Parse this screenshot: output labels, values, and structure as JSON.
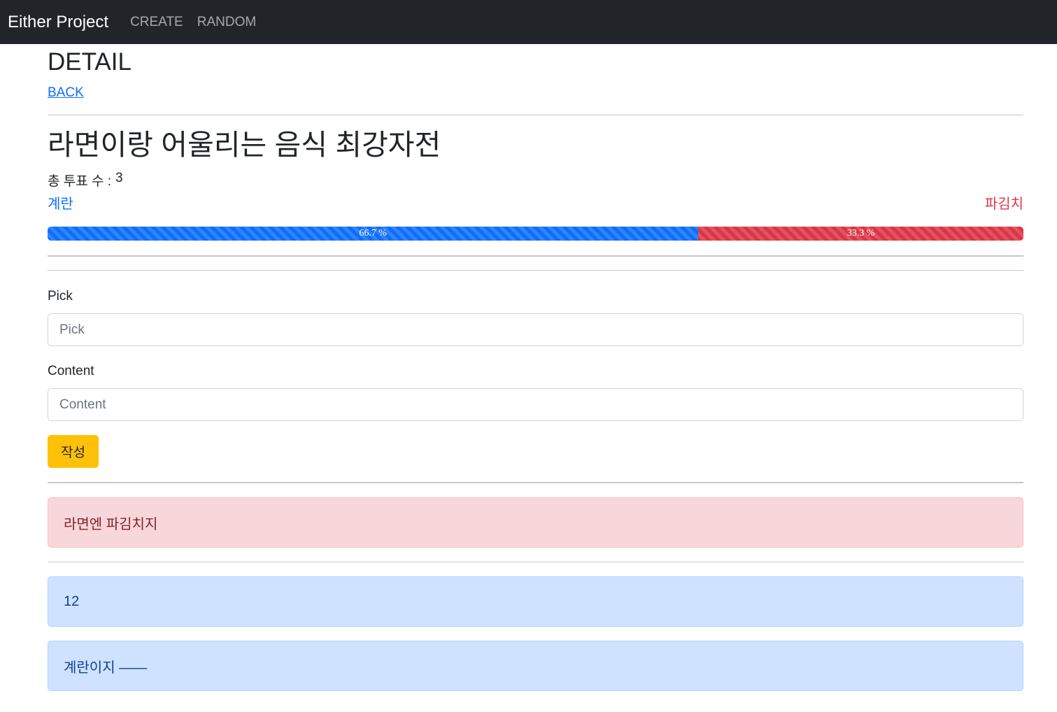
{
  "navbar": {
    "brand": "Either Project",
    "links": [
      "CREATE",
      "RANDOM"
    ]
  },
  "page": {
    "title": "DETAIL",
    "back_label": "BACK"
  },
  "question": {
    "title": "라면이랑 어울리는 음식 최강자전",
    "votes_label": "총 투표 수 :",
    "votes_count": "3",
    "choice_a": "계란",
    "choice_b": "파김치"
  },
  "progress": {
    "a_fraction": 0.667,
    "b_fraction": 0.333,
    "a_label": "66.7 %",
    "b_label": "33.3 %"
  },
  "form": {
    "pick_label": "Pick",
    "pick_placeholder": "Pick",
    "content_label": "Content",
    "content_placeholder": "Content",
    "submit_label": "작성"
  },
  "comments_b": [
    "라면엔 파김치지"
  ],
  "comments_a": [
    "12",
    "계란이지 ——"
  ],
  "colors": {
    "primary": "#0d6efd",
    "danger": "#dc3545",
    "warning": "#ffc107",
    "navbar": "#212529"
  }
}
